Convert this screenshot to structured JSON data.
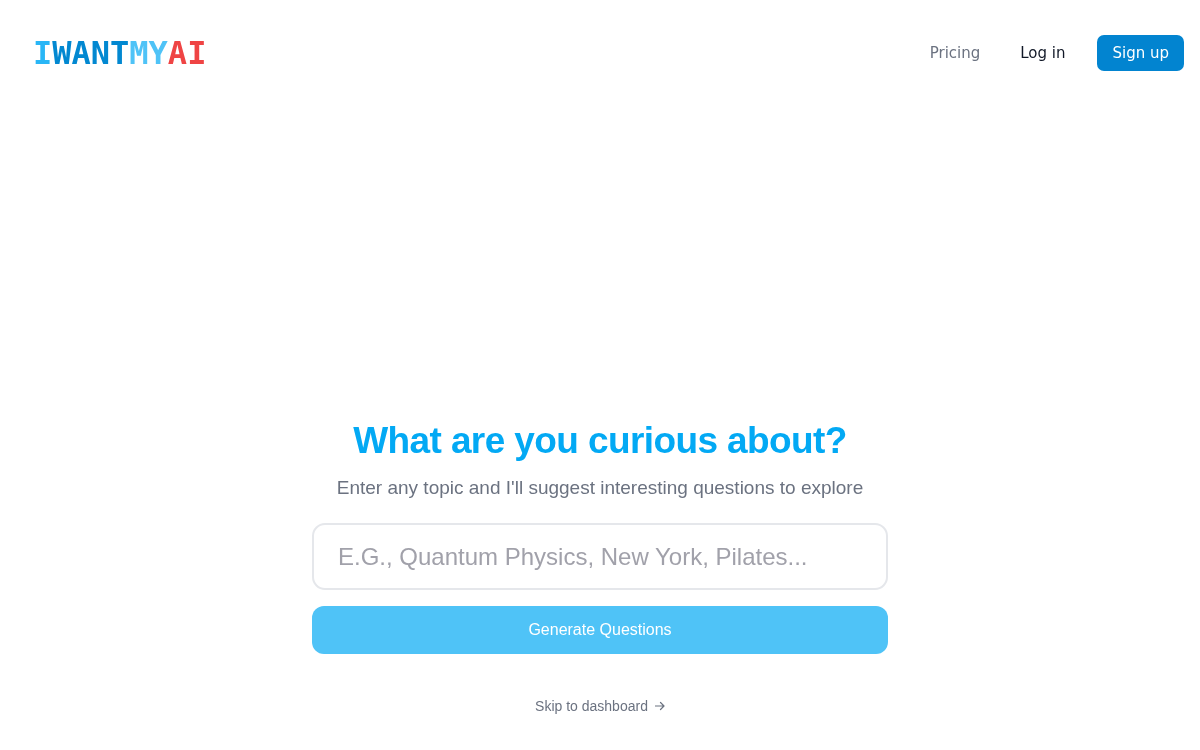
{
  "header": {
    "logo": [
      {
        "text": "I",
        "color": "#29b6f6"
      },
      {
        "text": "WANT",
        "color": "#0288d1"
      },
      {
        "text": "MY",
        "color": "#4fc3f7"
      },
      {
        "text": "AI",
        "color": "#ef4444"
      }
    ],
    "nav": [
      {
        "label": "Pricing",
        "kind": "muted"
      },
      {
        "label": "Log in",
        "kind": "plain"
      },
      {
        "label": "Sign up",
        "kind": "primary"
      }
    ]
  },
  "main": {
    "heading": "What are you curious about?",
    "subheading": "Enter any topic and I'll suggest interesting questions to explore",
    "topic_field": {
      "placeholder": "E.G., Quantum Physics, New York, Pilates..."
    },
    "generate_button": {
      "label": "Generate Questions",
      "disabled": true
    },
    "skip_link": {
      "label": "Skip to dashboard"
    }
  }
}
